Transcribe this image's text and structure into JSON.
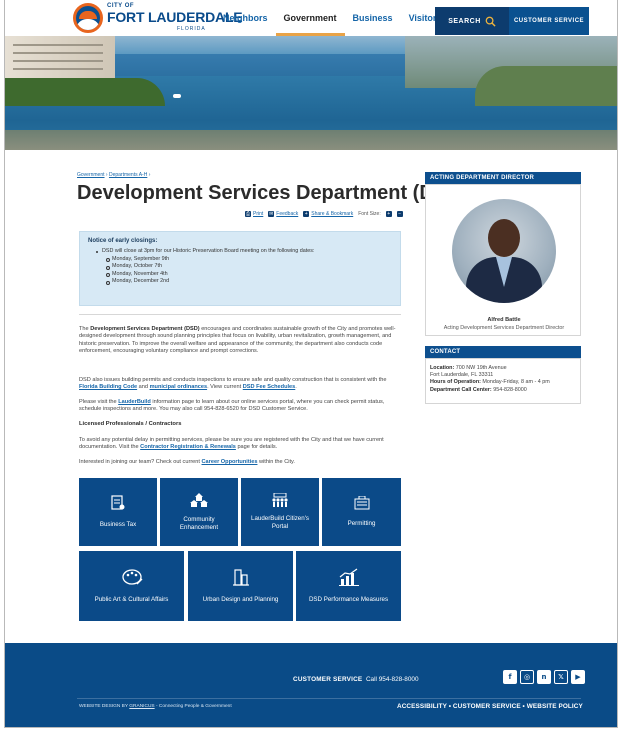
{
  "header": {
    "logo": {
      "city_of": "CITY OF",
      "name": "FORT LAUDERDALE",
      "state": "FLORIDA"
    },
    "nav": [
      {
        "label": "Neighbors",
        "active": false
      },
      {
        "label": "Government",
        "active": true
      },
      {
        "label": "Business",
        "active": false
      },
      {
        "label": "Visitors",
        "active": false
      }
    ],
    "search_label": "SEARCH",
    "customer_service_label": "CUSTOMER SERVICE"
  },
  "breadcrumb": {
    "parent": "Government",
    "current": "Departments A-H",
    "sep": "›"
  },
  "page_title": "Development Services Department (DSD)",
  "tools": {
    "print": "Print",
    "feedback": "Feedback",
    "share": "Share & Bookmark",
    "font_size": "Font Size:",
    "increase": "+",
    "decrease": "−"
  },
  "notice": {
    "title": "Notice of early closings:",
    "lead": "DSD will close at 3pm for our Historic Preservation Board meeting on the following dates:",
    "dates": [
      "Monday, September 9th",
      "Monday, October 7th",
      "Monday, November 4th",
      "Monday, December 2nd"
    ]
  },
  "intro": {
    "dept_name": "Development Services Department (DSD)",
    "text_before": "The ",
    "text_after": " encourages and coordinates sustainable growth of the City and promotes well-designed development through sound planning principles that focus on livability, urban revitalization, growth management, and historic preservation. To improve the overall welfare and appearance of the community, the department also conducts code enforcement, encouraging voluntary compliance and prompt corrections."
  },
  "permits": {
    "t1": "DSD also issues building permits and conducts inspections to ensure safe and quality construction that is consistent with the ",
    "link1": "Florida Building Code",
    "t2": " and ",
    "link2": "municipal ordinances",
    "t3": ". View current ",
    "link3": "DSD Fee Schedules",
    "t4": "."
  },
  "lauderbuild": {
    "t1": "Please visit the ",
    "link": "LauderBuild",
    "t2": " information page to learn about our online services portal, where you can check permit status, schedule inspections and more. You may also call 954-828-6520 for DSD Customer Service."
  },
  "licensed_heading": "Licensed Professionals / Contractors",
  "contractor": {
    "t1": "To avoid any potential delay in permitting services, please be sure you are registered with the City and that we have current documentation. Visit the ",
    "link": "Contractor Registration & Renewals",
    "t2": " page for details."
  },
  "careers": {
    "t1": "Interested in joining our team? Check out current ",
    "link": "Career Opportunities",
    "t2": " within the City."
  },
  "tiles": [
    {
      "label": "Business Tax",
      "icon": "tax-document-icon"
    },
    {
      "label": "Community Enhancement",
      "icon": "houses-icon"
    },
    {
      "label": "LauderBuild Citizen's Portal",
      "icon": "people-group-icon"
    },
    {
      "label": "Permitting",
      "icon": "building-icon"
    },
    {
      "label": "Public Art & Cultural Affairs",
      "icon": "art-palette-icon"
    },
    {
      "label": "Urban Design and Planning",
      "icon": "city-buildings-icon"
    },
    {
      "label": "DSD Performance Measures",
      "icon": "bar-chart-icon"
    }
  ],
  "sidebar": {
    "director_heading": "ACTING DEPARTMENT DIRECTOR",
    "director_name": "Alfred Battle",
    "director_role": "Acting Development Services Department Director",
    "contact_heading": "CONTACT",
    "location_label": "Location:",
    "address1": "700 NW 19th Avenue",
    "address2": "Fort Lauderdale, FL 33311",
    "hours_label": "Hours of Operation:",
    "hours": "Monday-Friday, 8 am - 4 pm",
    "phone_label": "Department Call Center:",
    "phone": "954-828-8000"
  },
  "footer": {
    "cs_label": "CUSTOMER SERVICE",
    "cs_phone": "Call 954-828-8000",
    "credit_prefix": "WEBSITE DESIGN BY ",
    "credit_brand": "GRANICUS",
    "credit_suffix": " - Connecting People & Government",
    "links": "ACCESSIBILITY  •  CUSTOMER SERVICE  •  WEBSITE POLICY",
    "social": [
      "facebook-icon",
      "instagram-icon",
      "nextdoor-icon",
      "x-icon",
      "youtube-icon"
    ],
    "social_glyphs": [
      "f",
      "◎",
      "n",
      "𝕏",
      "▶"
    ]
  },
  "colors": {
    "brand_blue": "#0b4a88",
    "accent_orange": "#e8651e",
    "link_blue": "#1565a8",
    "notice_bg": "#d7e9f5"
  }
}
